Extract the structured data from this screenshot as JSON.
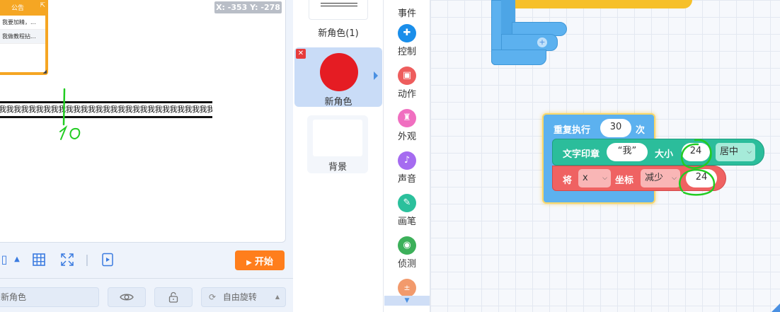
{
  "stage": {
    "coordinates": "X: -353  Y: -278",
    "notice": {
      "title": "公告",
      "items": [
        "我要加精，...",
        "我做教程拈..."
      ]
    },
    "text_sample": "我我我我我我我我我我我我我我我我我我我我我我我我我我我我我我"
  },
  "stage_toolbar": {
    "start_label": "开始"
  },
  "sprite_bar": {
    "name_value": "新角色",
    "rotation_label": "自由旋转"
  },
  "sprites": [
    {
      "name": "新角色(1)"
    },
    {
      "name": "新角色",
      "color": "#e51c23",
      "selected": true
    },
    {
      "name": "背景"
    }
  ],
  "categories": [
    {
      "label": "事件",
      "icon": "flag-icon",
      "color": "#f6c02a"
    },
    {
      "label": "控制",
      "icon": "gamepad-icon",
      "color": "#1a8eea"
    },
    {
      "label": "动作",
      "icon": "robot-icon",
      "color": "#ee5d5d"
    },
    {
      "label": "外观",
      "icon": "shirt-icon",
      "color": "#f06fc0"
    },
    {
      "label": "声音",
      "icon": "music-icon",
      "color": "#a56bf0"
    },
    {
      "label": "画笔",
      "icon": "pen-icon",
      "color": "#2bc09c"
    },
    {
      "label": "侦测",
      "icon": "target-icon",
      "color": "#3cb05a"
    },
    {
      "label": "",
      "icon": "math-icon",
      "color": "#f29a6c"
    }
  ],
  "code": {
    "repeat": {
      "label": "重复执行",
      "count": "30",
      "unit": "次"
    },
    "stamp": {
      "label": "文字印章",
      "text": "“我”",
      "size_label": "大小",
      "size": "24",
      "align": "居中"
    },
    "move": {
      "prefix": "将",
      "axis": "x",
      "coord_label": "坐标",
      "op": "减少",
      "amount": "24"
    }
  },
  "colors": {
    "accent": "#4a90e2",
    "start": "#ff7e1c",
    "control_block": "#5cb1ef",
    "pen_block": "#2bbd9b",
    "motion_block": "#ef6262",
    "annotation": "#22cc22"
  }
}
